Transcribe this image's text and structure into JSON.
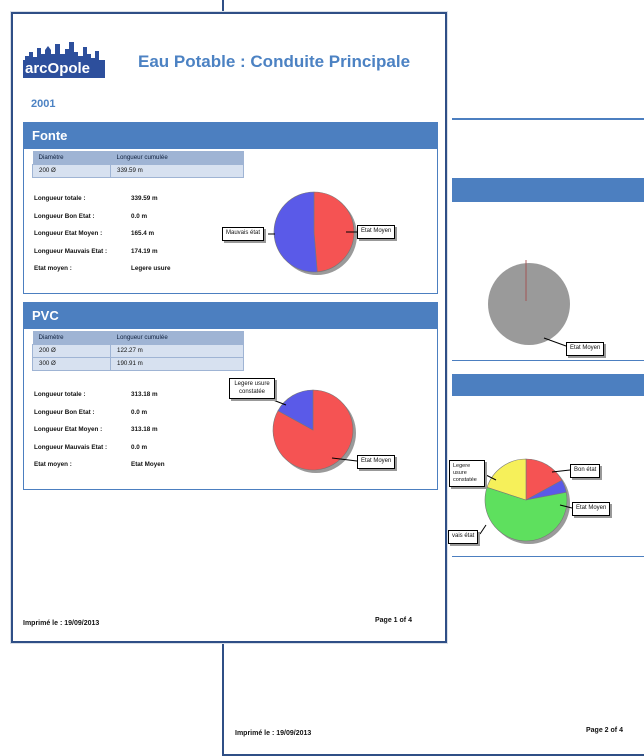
{
  "report_title": "Eau Potable : Conduite Principale",
  "logo_text": "arcOpole",
  "year": "2001",
  "colors": {
    "accent": "#4c7fc0",
    "pie_red": "#f55353",
    "pie_blue": "#5a5ae8",
    "pie_green": "#5ee05e",
    "pie_yellow": "#f6f05a"
  },
  "table_headers": {
    "diameter": "Diamètre",
    "cumulative_length": "Longueur cumulée"
  },
  "stat_labels": {
    "total": "Longueur totale :",
    "good": "Longueur Bon Etat :",
    "medium": "Longueur Etat Moyen :",
    "bad": "Longueur Mauvais Etat :",
    "avg": "Etat moyen :"
  },
  "sections": [
    {
      "name": "Fonte",
      "rows": [
        {
          "diameter": "200 Ø",
          "length": "339.59 m"
        }
      ],
      "stats": {
        "total": "339.59 m",
        "good": "0.0 m",
        "medium": "165.4 m",
        "bad": "174.19 m",
        "avg": "Legere usure"
      },
      "pie": [
        {
          "label": "Mauvais état",
          "value": 174.19,
          "color": "#5a5ae8"
        },
        {
          "label": "Etat Moyen",
          "value": 165.4,
          "color": "#f55353"
        }
      ]
    },
    {
      "name": "PVC",
      "rows": [
        {
          "diameter": "200 Ø",
          "length": "122.27 m"
        },
        {
          "diameter": "300 Ø",
          "length": "190.91 m"
        }
      ],
      "stats": {
        "total": "313.18 m",
        "good": "0.0 m",
        "medium": "313.18 m",
        "bad": "0.0 m",
        "avg": "Etat Moyen"
      },
      "pie": [
        {
          "label": "Legere usure constatée",
          "value": 0.17,
          "color": "#5a5ae8"
        },
        {
          "label": "Etat Moyen",
          "value": 0.83,
          "color": "#f55353"
        }
      ]
    }
  ],
  "page1_footer": {
    "printed": "Imprimé le : 19/09/2013",
    "page": "Page 1 of 4"
  },
  "page2_footer": {
    "printed": "Imprimé le : 19/09/2013",
    "page": "Page 2 of 4"
  },
  "page2": {
    "pie1_label": "Etat Moyen",
    "pie2_labels": {
      "good": "Bon état",
      "medium": "Etat Moyen",
      "bad": "vais état",
      "light": "Legere usure constatée"
    }
  }
}
